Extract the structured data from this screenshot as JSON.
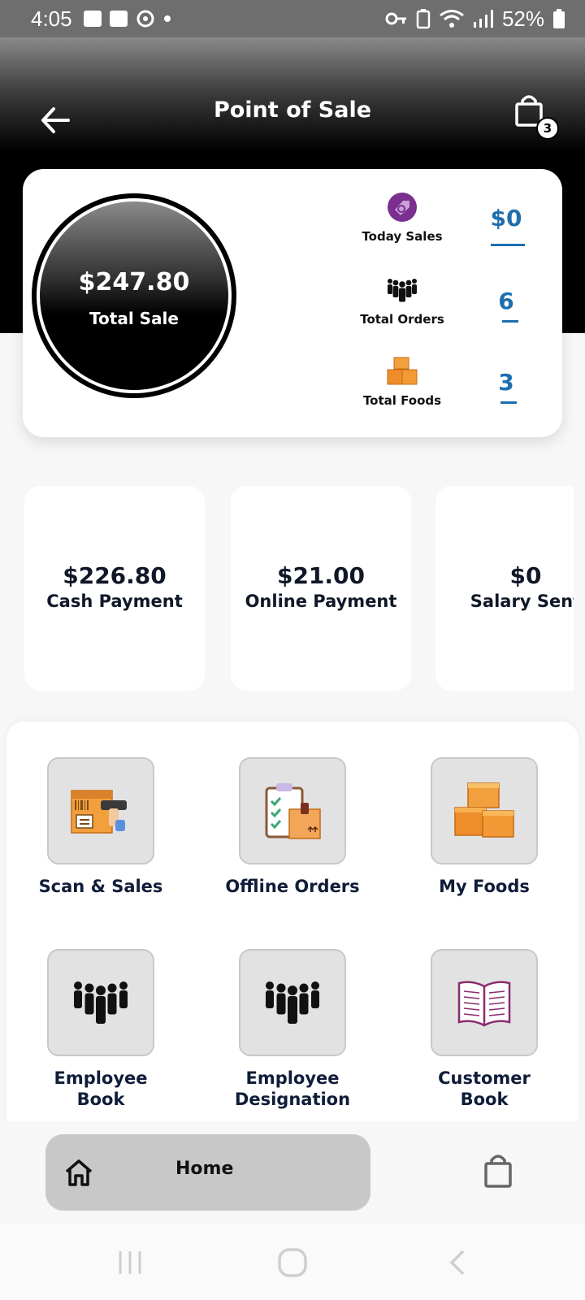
{
  "status_bar": {
    "time": "4:05",
    "battery": "52%"
  },
  "header": {
    "title": "Point of Sale",
    "cart_count": "3"
  },
  "summary": {
    "total_sale_amount": "$247.80",
    "total_sale_label": "Total Sale",
    "stats": [
      {
        "label": "Today Sales",
        "value": "$0",
        "icon": "sales-tag-icon"
      },
      {
        "label": "Total Orders",
        "value": "6",
        "icon": "people-group-icon"
      },
      {
        "label": "Total Foods",
        "value": "3",
        "icon": "boxes-icon"
      }
    ]
  },
  "payments": [
    {
      "amount": "$226.80",
      "label": "Cash Payment"
    },
    {
      "amount": "$21.00",
      "label": "Online Payment"
    },
    {
      "amount": "$0",
      "label": "Salary Sent"
    }
  ],
  "menu": [
    {
      "label": "Scan & Sales",
      "icon": "barcode-scanner-icon"
    },
    {
      "label": "Offline Orders",
      "icon": "clipboard-box-icon"
    },
    {
      "label": "My Foods",
      "icon": "boxes-icon"
    },
    {
      "label_line1": "Employee",
      "label_line2": "Book",
      "icon": "people-group-icon"
    },
    {
      "label_line1": "Employee",
      "label_line2": "Designation",
      "icon": "people-group-icon"
    },
    {
      "label_line1": "Customer",
      "label_line2": "Book",
      "icon": "open-book-icon"
    }
  ],
  "bottom_nav": {
    "home_label": "Home"
  },
  "colors": {
    "accent_blue": "#1f6fae",
    "dark_text": "#0f1d3a",
    "tile_bg": "#e2e2e2"
  }
}
